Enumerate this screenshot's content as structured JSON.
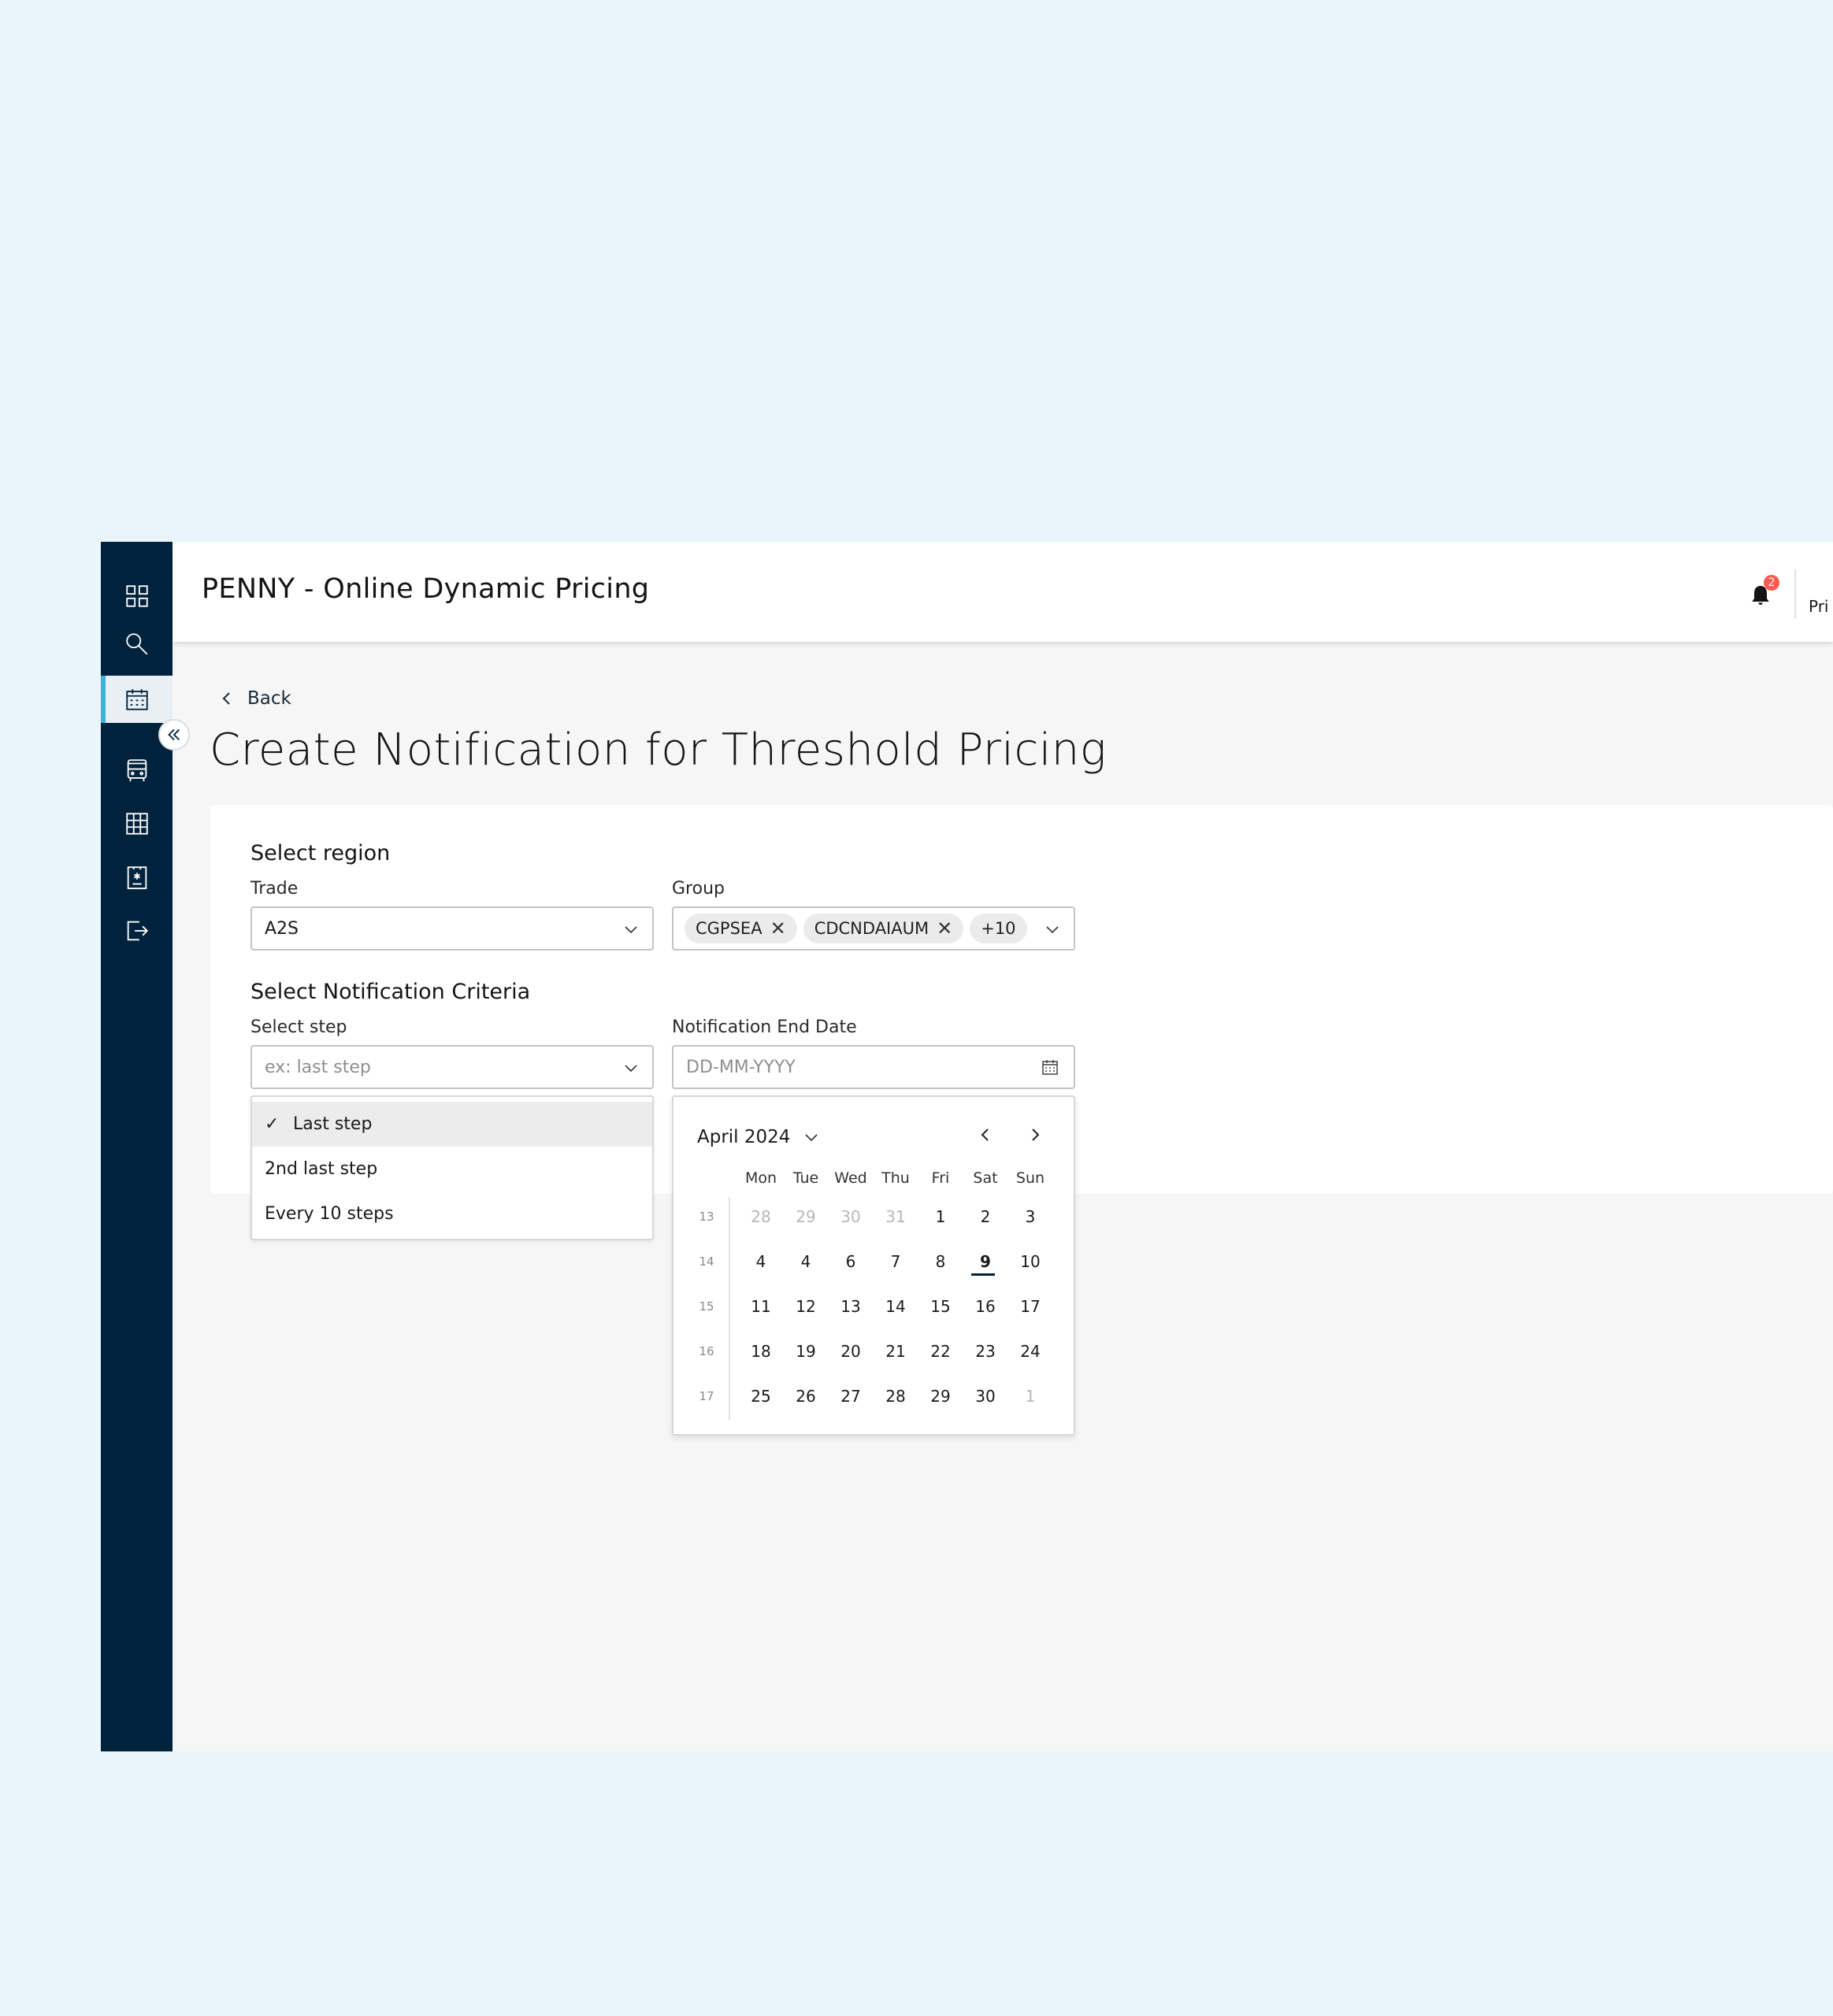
{
  "header": {
    "app_title": "PENNY - Online Dynamic Pricing",
    "notification_count": "2",
    "user_partial": "Pri"
  },
  "sidebar": {
    "items": [
      {
        "icon": "dashboard-grid-icon",
        "active": false
      },
      {
        "icon": "search-icon",
        "active": false
      },
      {
        "icon": "calendar-icon",
        "active": true
      },
      {
        "icon": "bus-icon",
        "active": false
      },
      {
        "icon": "table-grid-icon",
        "active": false
      },
      {
        "icon": "clipboard-icon",
        "active": false
      },
      {
        "icon": "logout-icon",
        "active": false
      }
    ],
    "collapse_icon": "double-chevron-left-icon"
  },
  "page": {
    "back_label": "Back",
    "title": "Create Notification for Threshold Pricing"
  },
  "form": {
    "region_title": "Select region",
    "trade_label": "Trade",
    "trade_value": "A2S",
    "group_label": "Group",
    "group_tags": [
      "CGPSEA",
      "CDCNDAIAUM"
    ],
    "group_more": "+10",
    "criteria_title": "Select Notification Criteria",
    "step_label": "Select step",
    "step_placeholder": "ex: last step",
    "end_date_label": "Notification End Date",
    "end_date_placeholder": "DD-MM-YYYY"
  },
  "step_dropdown": {
    "options": [
      {
        "label": "Last step",
        "selected": true
      },
      {
        "label": "2nd last step",
        "selected": false
      },
      {
        "label": "Every 10 steps",
        "selected": false
      }
    ]
  },
  "calendar": {
    "month_label": "April 2024",
    "weekdays": [
      "Mon",
      "Tue",
      "Wed",
      "Thu",
      "Fri",
      "Sat",
      "Sun"
    ],
    "weeks": [
      {
        "num": "13",
        "days": [
          {
            "d": "28",
            "other": true
          },
          {
            "d": "29",
            "other": true
          },
          {
            "d": "30",
            "other": true
          },
          {
            "d": "31",
            "other": true
          },
          {
            "d": "1"
          },
          {
            "d": "2"
          },
          {
            "d": "3"
          }
        ]
      },
      {
        "num": "14",
        "days": [
          {
            "d": "4"
          },
          {
            "d": "4"
          },
          {
            "d": "6"
          },
          {
            "d": "7"
          },
          {
            "d": "8"
          },
          {
            "d": "9",
            "today": true
          },
          {
            "d": "10"
          }
        ]
      },
      {
        "num": "15",
        "days": [
          {
            "d": "11"
          },
          {
            "d": "12"
          },
          {
            "d": "13"
          },
          {
            "d": "14"
          },
          {
            "d": "15"
          },
          {
            "d": "16"
          },
          {
            "d": "17"
          }
        ]
      },
      {
        "num": "16",
        "days": [
          {
            "d": "18"
          },
          {
            "d": "19"
          },
          {
            "d": "20"
          },
          {
            "d": "21"
          },
          {
            "d": "22"
          },
          {
            "d": "23"
          },
          {
            "d": "24"
          }
        ]
      },
      {
        "num": "17",
        "days": [
          {
            "d": "25"
          },
          {
            "d": "26"
          },
          {
            "d": "27"
          },
          {
            "d": "28"
          },
          {
            "d": "29"
          },
          {
            "d": "30"
          },
          {
            "d": "1",
            "other": true
          }
        ]
      }
    ]
  },
  "colors": {
    "sidebar_bg": "#00233d",
    "accent": "#42b0d5",
    "badge": "#ff5a4e"
  }
}
